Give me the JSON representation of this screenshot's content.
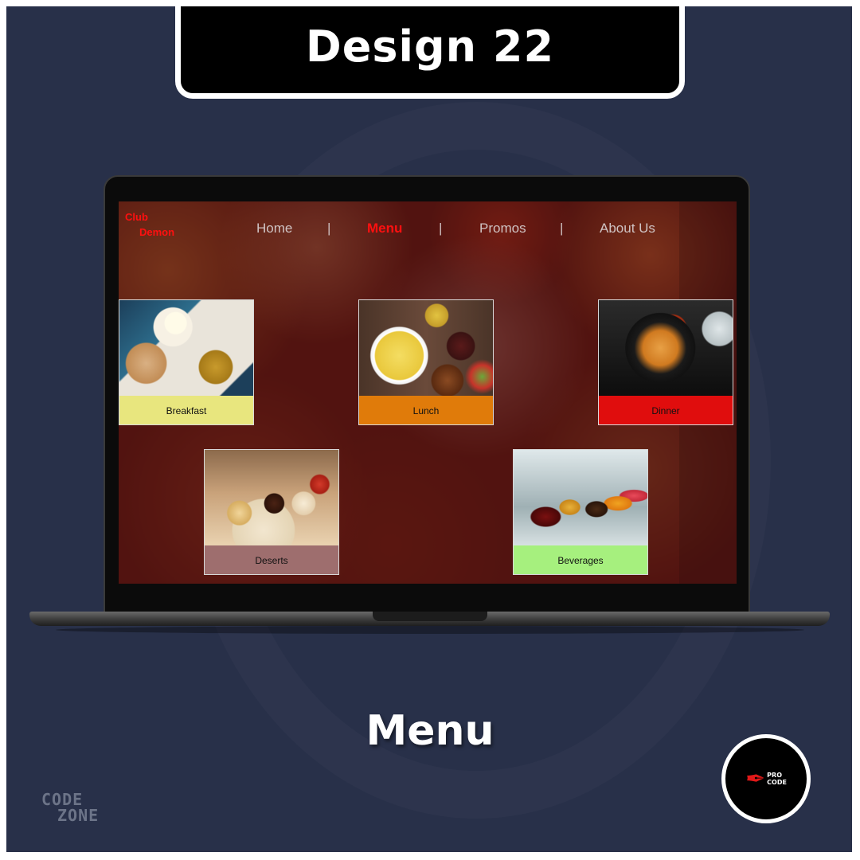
{
  "poster": {
    "title": "Design 22",
    "caption": "Menu",
    "watermark": {
      "line1": "CODE",
      "line2": "ZONE"
    },
    "logo": {
      "line1": "PRO",
      "line2": "CODE"
    }
  },
  "site": {
    "brand": {
      "line1": "Club",
      "line2": "Demon"
    },
    "nav": {
      "items": [
        {
          "label": "Home",
          "active": false
        },
        {
          "label": "Menu",
          "active": true
        },
        {
          "label": "Promos",
          "active": false
        },
        {
          "label": "About Us",
          "active": false
        }
      ],
      "separator": "|"
    },
    "menu_cards": [
      {
        "label": "Breakfast",
        "label_bg": "#e8e67e"
      },
      {
        "label": "Lunch",
        "label_bg": "#e07b0a"
      },
      {
        "label": "Dinner",
        "label_bg": "#e00d0d"
      },
      {
        "label": "Deserts",
        "label_bg": "#9e6e6e"
      },
      {
        "label": "Beverages",
        "label_bg": "#a6f07e"
      }
    ]
  },
  "colors": {
    "poster_bg": "#283049",
    "brand": "#ff1010",
    "nav_active": "#ff1010",
    "nav_text": "#cfc3c3"
  }
}
